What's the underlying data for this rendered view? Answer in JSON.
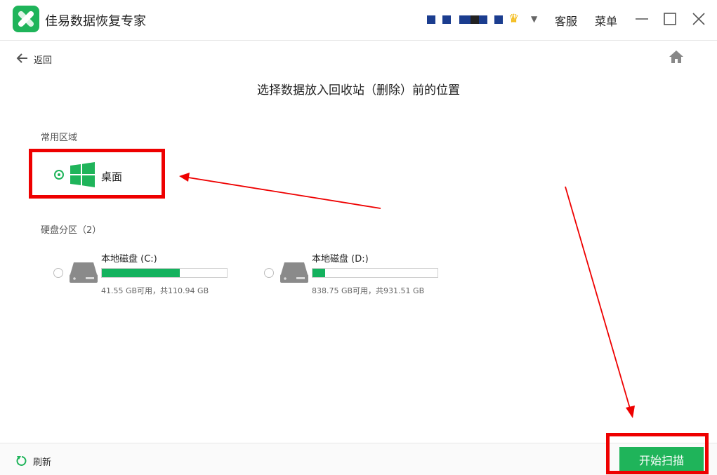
{
  "app": {
    "title": "佳易数据恢复专家"
  },
  "header": {
    "service_label": "客服",
    "menu_label": "菜单"
  },
  "nav": {
    "back_label": "返回"
  },
  "main": {
    "heading": "选择数据放入回收站（删除）前的位置",
    "common_section": {
      "label": "常用区域",
      "desktop_label": "桌面"
    },
    "disk_section": {
      "label": "硬盘分区（2）",
      "disks": [
        {
          "name": "本地磁盘 (C:)",
          "usage": "41.55 GB可用，共110.94 GB",
          "used_fraction": 0.626
        },
        {
          "name": "本地磁盘 (D:)",
          "usage": "838.75 GB可用，共931.51 GB",
          "used_fraction": 0.1
        }
      ]
    }
  },
  "footer": {
    "refresh_label": "刷新",
    "scan_label": "开始扫描"
  },
  "colors": {
    "accent": "#1fb45a",
    "annotation": "#ee0000"
  }
}
